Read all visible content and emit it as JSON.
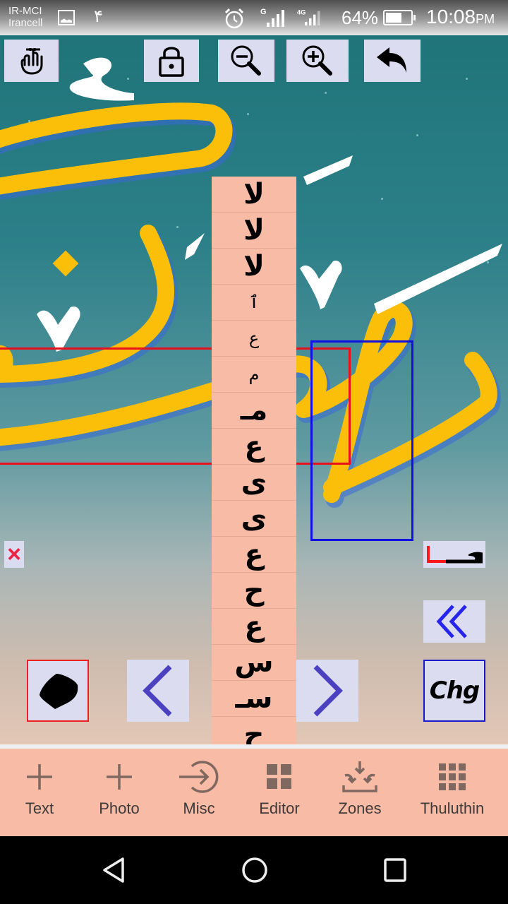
{
  "status_bar": {
    "carrier_line1": "IR-MCI",
    "carrier_line2": "Irancell",
    "notification_digit": "۴",
    "network_1": "G",
    "network_2": "4G",
    "battery_percent": "64%",
    "battery_level": 0.64,
    "time": "10:08",
    "time_suffix": "PM"
  },
  "toolbar": {
    "buttons": [
      {
        "name": "touch-mode",
        "icon": "hand-touch-icon"
      },
      {
        "name": "lock",
        "icon": "lock-icon"
      },
      {
        "name": "zoom-out",
        "icon": "zoom-out-icon"
      },
      {
        "name": "zoom-in",
        "icon": "zoom-in-icon"
      },
      {
        "name": "undo",
        "icon": "undo-icon"
      }
    ]
  },
  "canvas": {
    "background_art": "Ramadan calligraphy (yellow Thuluth strokes with white diacritics on teal gradient)",
    "colors": {
      "calligraphy_yellow": "#fbbf0a",
      "diacritic_white": "#ffffff",
      "selection_red": "#e8101d",
      "selection_blue": "#1010e0"
    }
  },
  "glyph_palette": {
    "items": [
      {
        "glyph": "لا",
        "size": "large"
      },
      {
        "glyph": "لا",
        "size": "large"
      },
      {
        "glyph": "لا",
        "size": "large"
      },
      {
        "glyph": "ٱ",
        "size": "small"
      },
      {
        "glyph": "ع",
        "size": "small"
      },
      {
        "glyph": "م",
        "size": "small"
      },
      {
        "glyph": "مـ",
        "size": "large"
      },
      {
        "glyph": "ع",
        "size": "large"
      },
      {
        "glyph": "ى",
        "size": "large"
      },
      {
        "glyph": "ى",
        "size": "large"
      },
      {
        "glyph": "ع",
        "size": "large"
      },
      {
        "glyph": "ح",
        "size": "large"
      },
      {
        "glyph": "ع",
        "size": "large"
      },
      {
        "glyph": "س",
        "size": "large"
      },
      {
        "glyph": "سـ",
        "size": "large"
      },
      {
        "glyph": "ح",
        "size": "large"
      }
    ]
  },
  "side_controls": {
    "delete_label": "×",
    "kashida_preview": "حـــ",
    "collapse_label": "«",
    "shape_label": "shape",
    "prev_label": "<",
    "next_label": ">",
    "change_label": "Chg"
  },
  "bottom_toolbar": {
    "items": [
      {
        "label": "Text",
        "icon": "plus-icon"
      },
      {
        "label": "Photo",
        "icon": "plus-icon"
      },
      {
        "label": "Misc",
        "icon": "arrow-circle-icon"
      },
      {
        "label": "Editor",
        "icon": "grid-2x2-icon"
      },
      {
        "label": "Zones",
        "icon": "zones-download-icon"
      },
      {
        "label": "Thuluthin",
        "icon": "grid-3x3-icon"
      }
    ]
  },
  "android_nav": {
    "back": "back",
    "home": "home",
    "recents": "recents"
  }
}
